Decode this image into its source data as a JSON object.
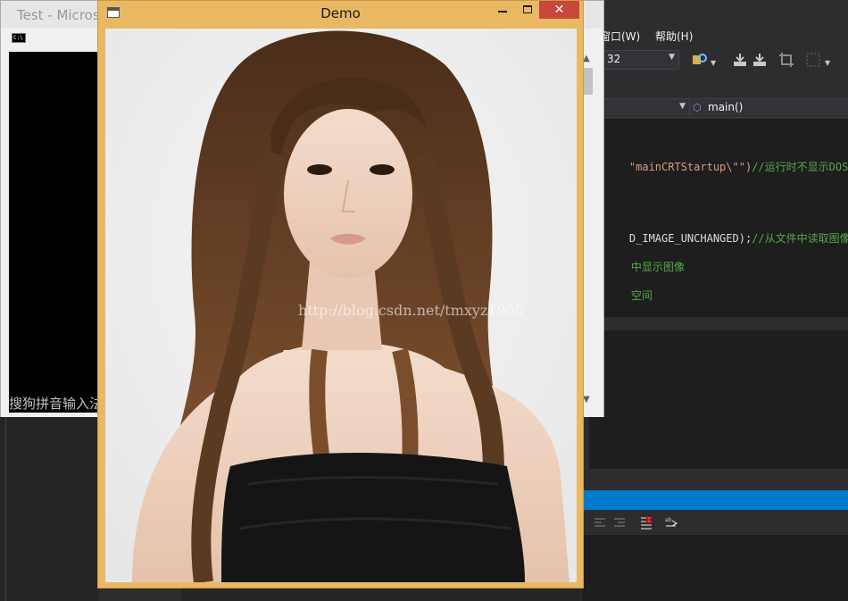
{
  "visual_studio": {
    "menu": {
      "window_partial": "窗口(W)",
      "help": "帮助(H)"
    },
    "toolbar": {
      "platform_value": "32"
    },
    "navigation": {
      "member": "main()"
    },
    "editor_lines": [
      {
        "str": "\"mainCRTStartup\\\"\")",
        "comment": "//运行时不显示DOS框"
      },
      {
        "code": "D_IMAGE_UNCHANGED);",
        "comment": "//从文件中读取图像"
      },
      {
        "comment": "中显示图像"
      },
      {
        "comment": "空间"
      }
    ]
  },
  "console_window": {
    "title": "Test - Micros",
    "ime_text": "搜狗拼音输入法"
  },
  "demo_window": {
    "title": "Demo",
    "close_glyph": "✕",
    "watermark": "http://blog.csdn.net/tmxyz1950"
  },
  "colors": {
    "demo_frame": "#e9b863",
    "close_button": "#c7473b",
    "vs_blue": "#007acc",
    "hair": "#5b3a22",
    "skin": "#f1d6c5"
  }
}
